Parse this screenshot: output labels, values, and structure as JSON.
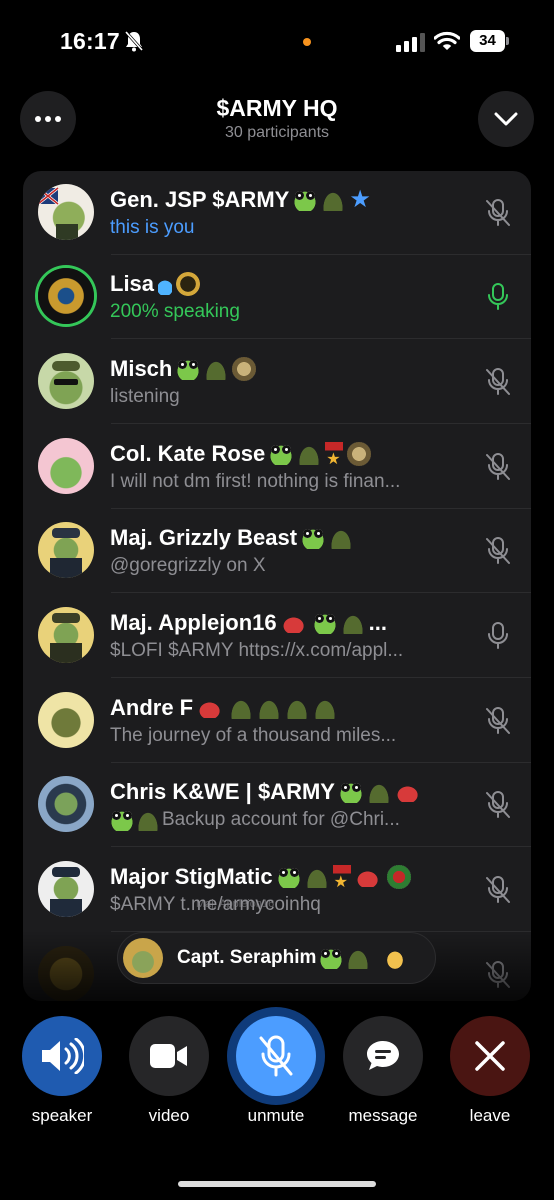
{
  "status_bar": {
    "time": "16:17",
    "battery": "34"
  },
  "header": {
    "title": "$ARMY HQ",
    "subtitle": "30 participants"
  },
  "participants": [
    {
      "name": "Gen. JSP $ARMY",
      "status": "this is you"
    },
    {
      "name": "Lisa",
      "status": "200% speaking"
    },
    {
      "name": "Misch",
      "status": "listening"
    },
    {
      "name": "Col. Kate Rose",
      "status": "I will not dm first! nothing is finan..."
    },
    {
      "name": "Maj. Grizzly Beast",
      "status": "@goregrizzly on X"
    },
    {
      "name": "Maj. Applejon16",
      "status": "$LOFI $ARMY https://x.com/appl..."
    },
    {
      "name": "Andre F",
      "status": "The journey of a thousand miles..."
    },
    {
      "name": "Chris K&WE | $ARMY",
      "status": "Backup account for @Chri..."
    },
    {
      "name": "Major StigMatic",
      "status": "$ARMY t.me/armycoinhq"
    }
  ],
  "name_suffix": "...",
  "ghost_text": "Maj. Applejon16",
  "speaking_pill": {
    "name": "Capt. Seraphim"
  },
  "controls": {
    "speaker": "speaker",
    "video": "video",
    "unmute": "unmute",
    "message": "message",
    "leave": "leave"
  },
  "colors": {
    "accent_blue": "#4c9dff",
    "speaking_green": "#34c759",
    "leave_red": "#4a1512",
    "row_bg": "#1c1c1e"
  }
}
